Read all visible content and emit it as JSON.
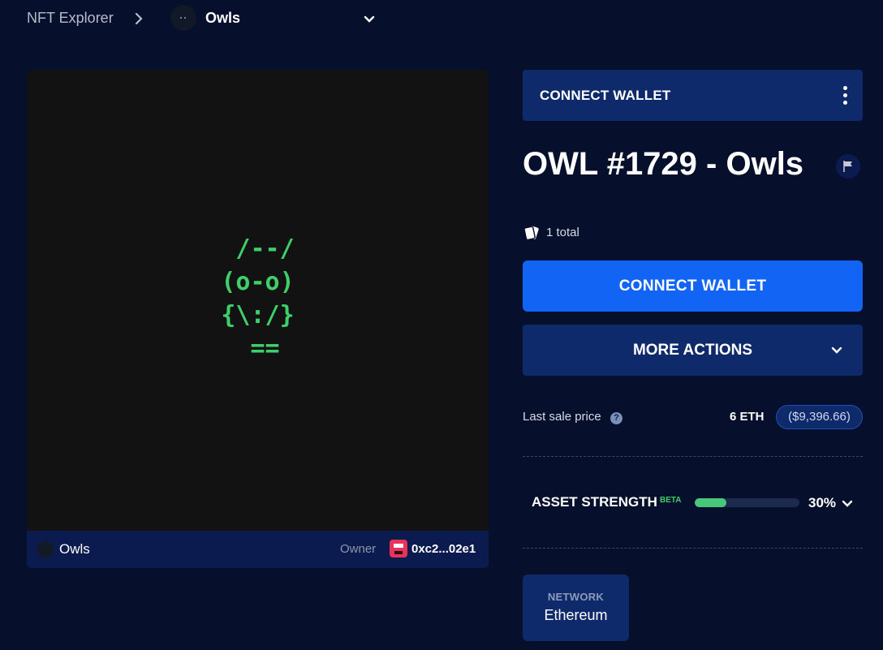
{
  "breadcrumb": {
    "root": "NFT Explorer",
    "current": "Owls"
  },
  "artwork": {
    "ascii_art": " /--/\n(o-o)\n{\\:/}\n ==",
    "art_color": "#3fcf6a",
    "collection": "Owls",
    "owner_label": "Owner",
    "owner_address": "0xc2...02e1"
  },
  "connect_bar": {
    "label": "CONNECT WALLET"
  },
  "asset": {
    "title": "OWL #1729 - Owls",
    "total": "1 total"
  },
  "actions": {
    "primary_label": "CONNECT WALLET",
    "more_label": "MORE ACTIONS"
  },
  "sale": {
    "label": "Last sale price",
    "help": "?",
    "eth": "6 ETH",
    "usd": "($9,396.66)"
  },
  "strength": {
    "label": "ASSET STRENGTH",
    "badge": "BETA",
    "percent_text": "30%",
    "percent_value": 0.3
  },
  "network": {
    "label": "NETWORK",
    "value": "Ethereum"
  },
  "colors": {
    "background": "#060f2c",
    "accent": "#1264f5",
    "panel": "#0e2a6a",
    "success": "#48c77a"
  }
}
